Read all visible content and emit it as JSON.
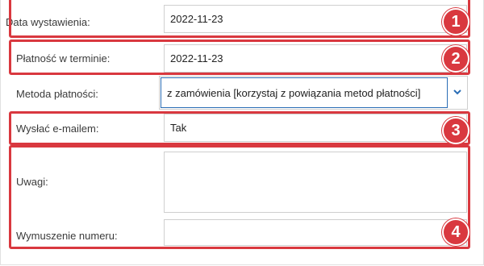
{
  "form": {
    "issue_date": {
      "label": "Data wystawienia:",
      "value": "2022-11-23"
    },
    "payment_due": {
      "label": "Płatność w terminie:",
      "value": "2022-11-23"
    },
    "payment_method": {
      "label": "Metoda płatności:",
      "value": "z zamówienia [korzystaj z powiązania metod płatności]"
    },
    "send_email": {
      "label": "Wysłać e-mailem:",
      "value": "Tak"
    },
    "notes": {
      "label": "Uwagi:",
      "value": ""
    },
    "force_number": {
      "label": "Wymuszenie numeru:",
      "value": ""
    }
  },
  "badges": [
    "1",
    "2",
    "3",
    "4"
  ],
  "colors": {
    "highlight": "#d9383f",
    "focus": "#2a6db5"
  },
  "icons": {
    "dropdown": "chevron-down-icon"
  }
}
